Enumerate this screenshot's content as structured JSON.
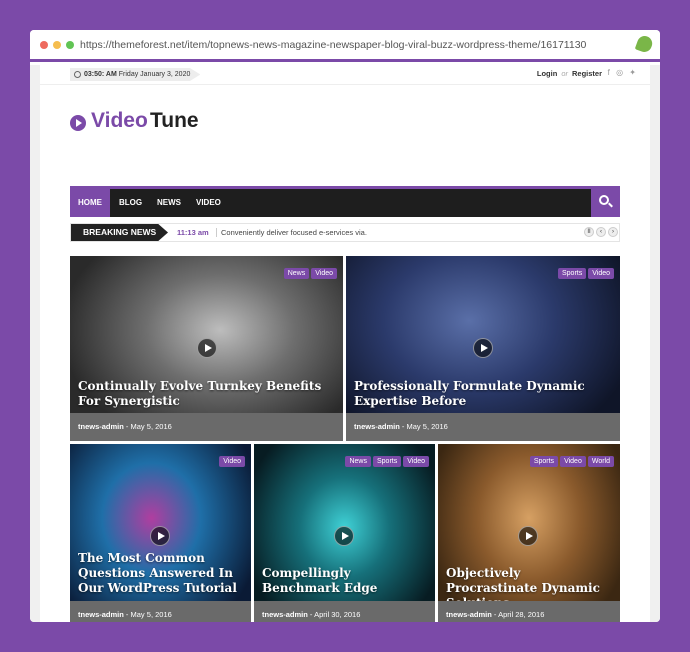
{
  "browser": {
    "url": "https://themeforest.net/item/topnews-news-magazine-newspaper-blog-viral-buzz-wordpress-theme/16171130",
    "icon": "envato-leaf-icon"
  },
  "topbar": {
    "time": "03:50: AM",
    "date": "Friday January 3, 2020",
    "login": "Login",
    "or": "or",
    "register": "Register"
  },
  "logo": {
    "part1": "Video",
    "part2": "Tune"
  },
  "nav": {
    "items": [
      "HOME",
      "BLOG",
      "NEWS",
      "VIDEO"
    ],
    "active": "HOME"
  },
  "breaking": {
    "label": "BREAKING NEWS",
    "time": "11:13 am",
    "text": "Conveniently deliver focused e-services via."
  },
  "posts": [
    {
      "title": "Continually Evolve Turnkey Benefits For Synergistic",
      "author": "tnews-admin",
      "date": "May 5, 2016",
      "tags": [
        "News",
        "Video"
      ]
    },
    {
      "title": "Professionally Formulate Dynamic Expertise Before",
      "author": "tnews-admin",
      "date": "May 5, 2016",
      "tags": [
        "Sports",
        "Video"
      ]
    },
    {
      "title": "The Most Common Questions Answered In Our WordPress Tutorial",
      "author": "tnews-admin",
      "date": "May 5, 2016",
      "tags": [
        "Video"
      ]
    },
    {
      "title": "Compellingly Benchmark Edge",
      "author": "tnews-admin",
      "date": "April 30, 2016",
      "tags": [
        "News",
        "Sports",
        "Video"
      ]
    },
    {
      "title": "Objectively Procrastinate Dynamic Solutions",
      "author": "tnews-admin",
      "date": "April 28, 2016",
      "tags": [
        "Sports",
        "Video",
        "World"
      ]
    }
  ],
  "colors": {
    "accent": "#7b4aa8",
    "nav_bg": "#1e1e1e",
    "card_footer": "#6a6a6a"
  }
}
